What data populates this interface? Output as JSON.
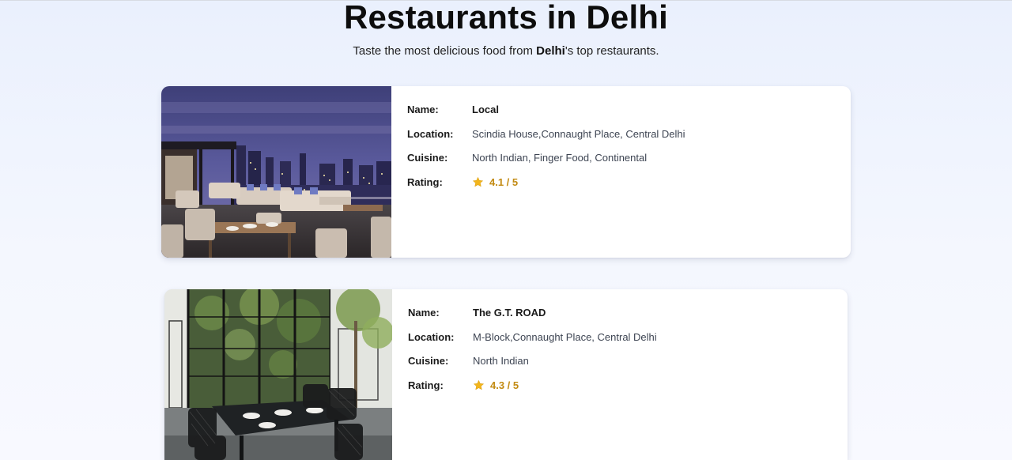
{
  "page": {
    "title": "Restaurants in Delhi",
    "subtitle_before": "Taste the most delicious food from ",
    "subtitle_bold": "Delhi",
    "subtitle_after": "'s top restaurants."
  },
  "labels": {
    "name": "Name:",
    "location": "Location:",
    "cuisine": "Cuisine:",
    "rating": "Rating:"
  },
  "restaurants": [
    {
      "name": "Local",
      "location": "Scindia House,Connaught Place, Central Delhi",
      "cuisine": "North Indian, Finger Food, Continental",
      "rating": "4.1 / 5",
      "image_icon": "rooftop-restaurant-photo"
    },
    {
      "name": "The G.T. ROAD",
      "location": "M-Block,Connaught Place, Central Delhi",
      "cuisine": "North Indian",
      "rating": "4.3 / 5",
      "image_icon": "indoor-dining-photo"
    }
  ],
  "colors": {
    "rating": "#c28a12",
    "star": "#f2b51c",
    "background": "#eef3fd"
  }
}
